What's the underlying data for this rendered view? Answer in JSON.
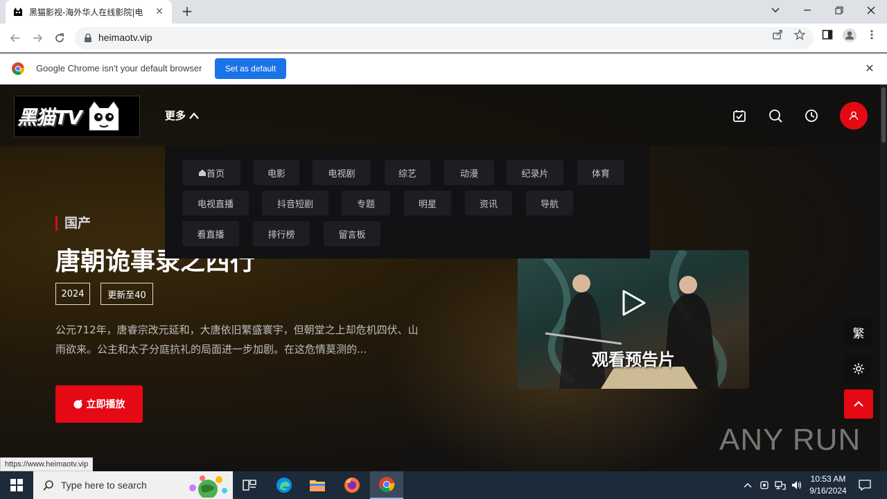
{
  "browser": {
    "tab_title": "黑猫影视-海外华人在线影院|电",
    "url": "heimaotv.vip",
    "infobar_message": "Google Chrome isn't your default browser",
    "infobar_button": "Set as default",
    "status_url": "https://www.heimaotv.vip"
  },
  "site": {
    "logo_text": "黑猫TV",
    "more_label": "更多",
    "nav": [
      {
        "label": "首页"
      },
      {
        "label": "电影"
      },
      {
        "label": "电视剧"
      },
      {
        "label": "综艺"
      },
      {
        "label": "动漫"
      },
      {
        "label": "纪录片"
      },
      {
        "label": "体育"
      },
      {
        "label": "电视直播"
      },
      {
        "label": "抖音短剧"
      },
      {
        "label": "专题"
      },
      {
        "label": "明星"
      },
      {
        "label": "资讯"
      },
      {
        "label": "导航"
      },
      {
        "label": "看直播"
      },
      {
        "label": "排行榜"
      },
      {
        "label": "留言板"
      }
    ]
  },
  "hero": {
    "category": "国产",
    "title": "唐朝诡事录之西行",
    "year": "2024",
    "update": "更新至40",
    "description": "公元712年，唐睿宗改元延和，大唐依旧繁盛寰宇，但朝堂之上却危机四伏、山雨欲来。公主和太子分庭抗礼的局面进一步加剧。在这危情莫测的...",
    "play_label": "立即播放",
    "trailer_caption": "观看预告片"
  },
  "floating": {
    "traditional_label": "繁"
  },
  "watermark": "ANY RUN",
  "taskbar": {
    "search_placeholder": "Type here to search",
    "time": "10:53 AM",
    "date": "9/16/2024"
  },
  "colors": {
    "accent": "#e50914",
    "chrome_blue": "#1a73e8"
  }
}
